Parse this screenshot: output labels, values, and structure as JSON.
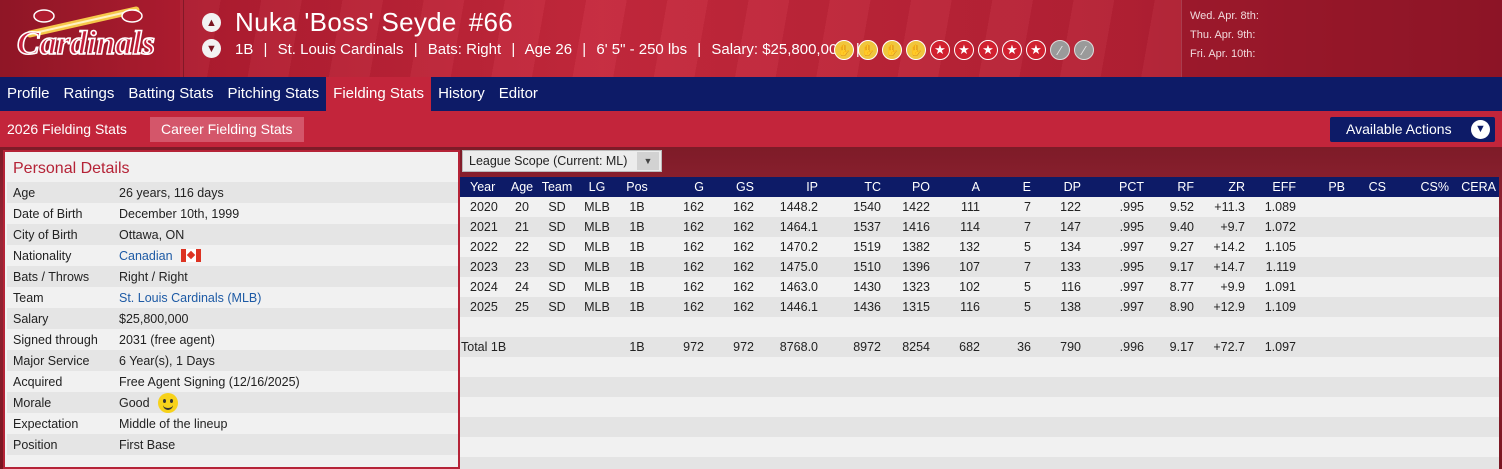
{
  "player": {
    "name": "Nuka 'Boss' Seyde",
    "number": "#66",
    "position": "1B",
    "team": "St. Louis Cardinals",
    "bats": "Bats: Right",
    "age": "Age 26",
    "height_weight": "6' 5\" - 250 lbs",
    "salary": "Salary: $25,800,000",
    "divider": "|"
  },
  "logo": {
    "text": "Cardinals"
  },
  "ratings_icons": [
    "glove-icon",
    "glove-icon",
    "glove-icon",
    "glove-icon",
    "star-icon",
    "star-icon",
    "star-icon",
    "star-icon",
    "star-icon",
    "bat-icon",
    "bat-icon"
  ],
  "schedule": [
    "Wed. Apr. 8th:",
    "Thu. Apr. 9th:",
    "Fri. Apr. 10th:"
  ],
  "nav": {
    "tabs": [
      "Profile",
      "Ratings",
      "Batting Stats",
      "Pitching Stats",
      "Fielding Stats",
      "History",
      "Editor"
    ],
    "active": "Fielding Stats"
  },
  "subnav": {
    "tabs": [
      "2026 Fielding Stats",
      "Career Fielding Stats"
    ],
    "active": "Career Fielding Stats",
    "actions_label": "Available Actions"
  },
  "details": {
    "title": "Personal Details",
    "rows": [
      {
        "label": "Age",
        "value": "26 years, 116 days"
      },
      {
        "label": "Date of Birth",
        "value": "December 10th, 1999"
      },
      {
        "label": "City of Birth",
        "value": "Ottawa, ON"
      },
      {
        "label": "Nationality",
        "value": "Canadian"
      },
      {
        "label": "Bats / Throws",
        "value": "Right / Right"
      },
      {
        "label": "Team",
        "value": "St. Louis Cardinals (MLB)"
      },
      {
        "label": "Salary",
        "value": "$25,800,000"
      },
      {
        "label": "Signed through",
        "value": "2031 (free agent)"
      },
      {
        "label": "Major Service",
        "value": "6 Year(s), 1 Days"
      },
      {
        "label": "Acquired",
        "value": "Free Agent Signing (12/16/2025)"
      },
      {
        "label": "Morale",
        "value": "Good"
      },
      {
        "label": "Expectation",
        "value": "Middle of the lineup"
      },
      {
        "label": "Position",
        "value": "First Base"
      }
    ]
  },
  "scope": {
    "label": "League Scope  (Current: ML)"
  },
  "stats": {
    "columns": [
      "Year",
      "Age",
      "Team",
      "LG",
      "Pos",
      "G",
      "GS",
      "IP",
      "TC",
      "PO",
      "A",
      "E",
      "DP",
      "PCT",
      "RF",
      "ZR",
      "EFF",
      "PB",
      "CS",
      "CS%",
      "CERA"
    ],
    "rows": [
      [
        "2020",
        "20",
        "SD",
        "MLB",
        "1B",
        "162",
        "162",
        "1448.2",
        "1540",
        "1422",
        "111",
        "7",
        "122",
        ".995",
        "9.52",
        "+11.3",
        "1.089"
      ],
      [
        "2021",
        "21",
        "SD",
        "MLB",
        "1B",
        "162",
        "162",
        "1464.1",
        "1537",
        "1416",
        "114",
        "7",
        "147",
        ".995",
        "9.40",
        "+9.7",
        "1.072"
      ],
      [
        "2022",
        "22",
        "SD",
        "MLB",
        "1B",
        "162",
        "162",
        "1470.2",
        "1519",
        "1382",
        "132",
        "5",
        "134",
        ".997",
        "9.27",
        "+14.2",
        "1.105"
      ],
      [
        "2023",
        "23",
        "SD",
        "MLB",
        "1B",
        "162",
        "162",
        "1475.0",
        "1510",
        "1396",
        "107",
        "7",
        "133",
        ".995",
        "9.17",
        "+14.7",
        "1.119"
      ],
      [
        "2024",
        "24",
        "SD",
        "MLB",
        "1B",
        "162",
        "162",
        "1463.0",
        "1430",
        "1323",
        "102",
        "5",
        "116",
        ".997",
        "8.77",
        "+9.9",
        "1.091"
      ],
      [
        "2025",
        "25",
        "SD",
        "MLB",
        "1B",
        "162",
        "162",
        "1446.1",
        "1436",
        "1315",
        "116",
        "5",
        "138",
        ".997",
        "8.90",
        "+12.9",
        "1.109"
      ]
    ],
    "total": [
      "Total 1B",
      "",
      "",
      "",
      "1B",
      "972",
      "972",
      "8768.0",
      "8972",
      "8254",
      "682",
      "36",
      "790",
      ".996",
      "9.17",
      "+72.7",
      "1.097"
    ]
  }
}
